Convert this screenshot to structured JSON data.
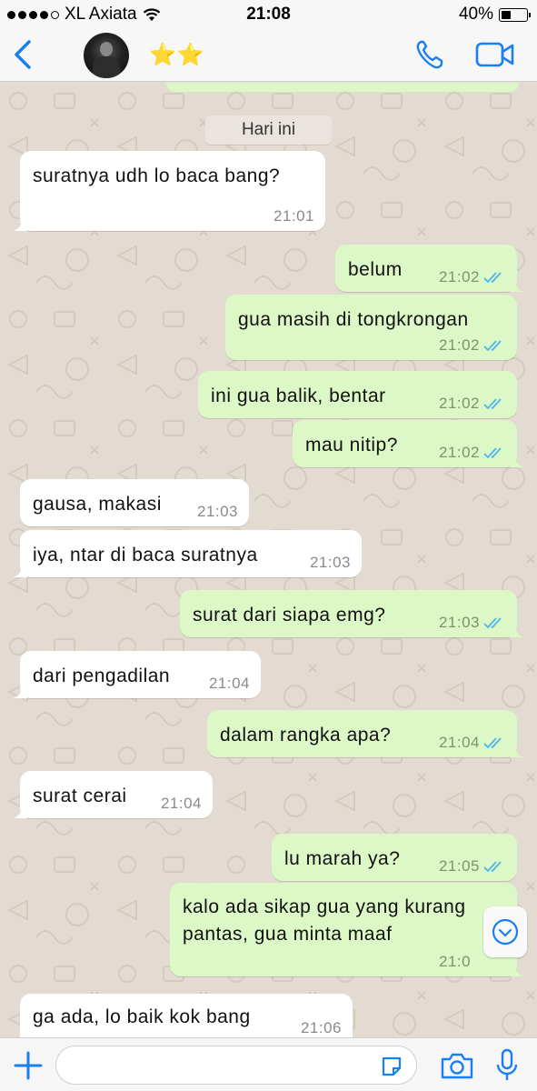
{
  "status_bar": {
    "carrier": "XL Axiata",
    "time": "21:08",
    "battery": "40%",
    "battery_level": 0.4
  },
  "header": {
    "contact_name": "⭐⭐",
    "icons": [
      "back-chevron-icon",
      "phone-icon",
      "video-camera-icon"
    ]
  },
  "chat": {
    "date_divider": "Hari ini",
    "messages": [
      {
        "dir": "in",
        "text": "suratnya udh lo baca bang?",
        "time": "21:01"
      },
      {
        "dir": "out",
        "text": "belum",
        "time": "21:02",
        "read": true
      },
      {
        "dir": "out",
        "text": "gua masih di tongkrongan",
        "time": "21:02",
        "read": true
      },
      {
        "dir": "out",
        "text": "ini gua balik, bentar",
        "time": "21:02",
        "read": true
      },
      {
        "dir": "out",
        "text": "mau nitip?",
        "time": "21:02",
        "read": true
      },
      {
        "dir": "in",
        "text": "gausa, makasi",
        "time": "21:03"
      },
      {
        "dir": "in",
        "text": "iya, ntar di baca suratnya",
        "time": "21:03"
      },
      {
        "dir": "out",
        "text": "surat dari siapa emg?",
        "time": "21:03",
        "read": true
      },
      {
        "dir": "in",
        "text": "dari pengadilan",
        "time": "21:04"
      },
      {
        "dir": "out",
        "text": "dalam rangka apa?",
        "time": "21:04",
        "read": true
      },
      {
        "dir": "in",
        "text": "surat cerai",
        "time": "21:04"
      },
      {
        "dir": "out",
        "text": "lu marah ya?",
        "time": "21:05",
        "read": true
      },
      {
        "dir": "out",
        "text_line1": "kalo ada sikap gua yang kurang",
        "text_line2": "pantas, gua minta maaf",
        "time": "21:0"
      },
      {
        "dir": "in",
        "text": "ga ada, lo baik kok bang",
        "time": "21:06"
      }
    ]
  },
  "input_bar": {
    "placeholder": "",
    "icons": [
      "plus-icon",
      "sticker-icon",
      "camera-icon",
      "microphone-icon"
    ]
  },
  "colors": {
    "accent": "#1a7ff5",
    "outgoing_bubble": "#dcf8c6",
    "incoming_bubble": "#ffffff",
    "read_ticks": "#4fb6ec",
    "chat_background": "#e3dbd1"
  }
}
